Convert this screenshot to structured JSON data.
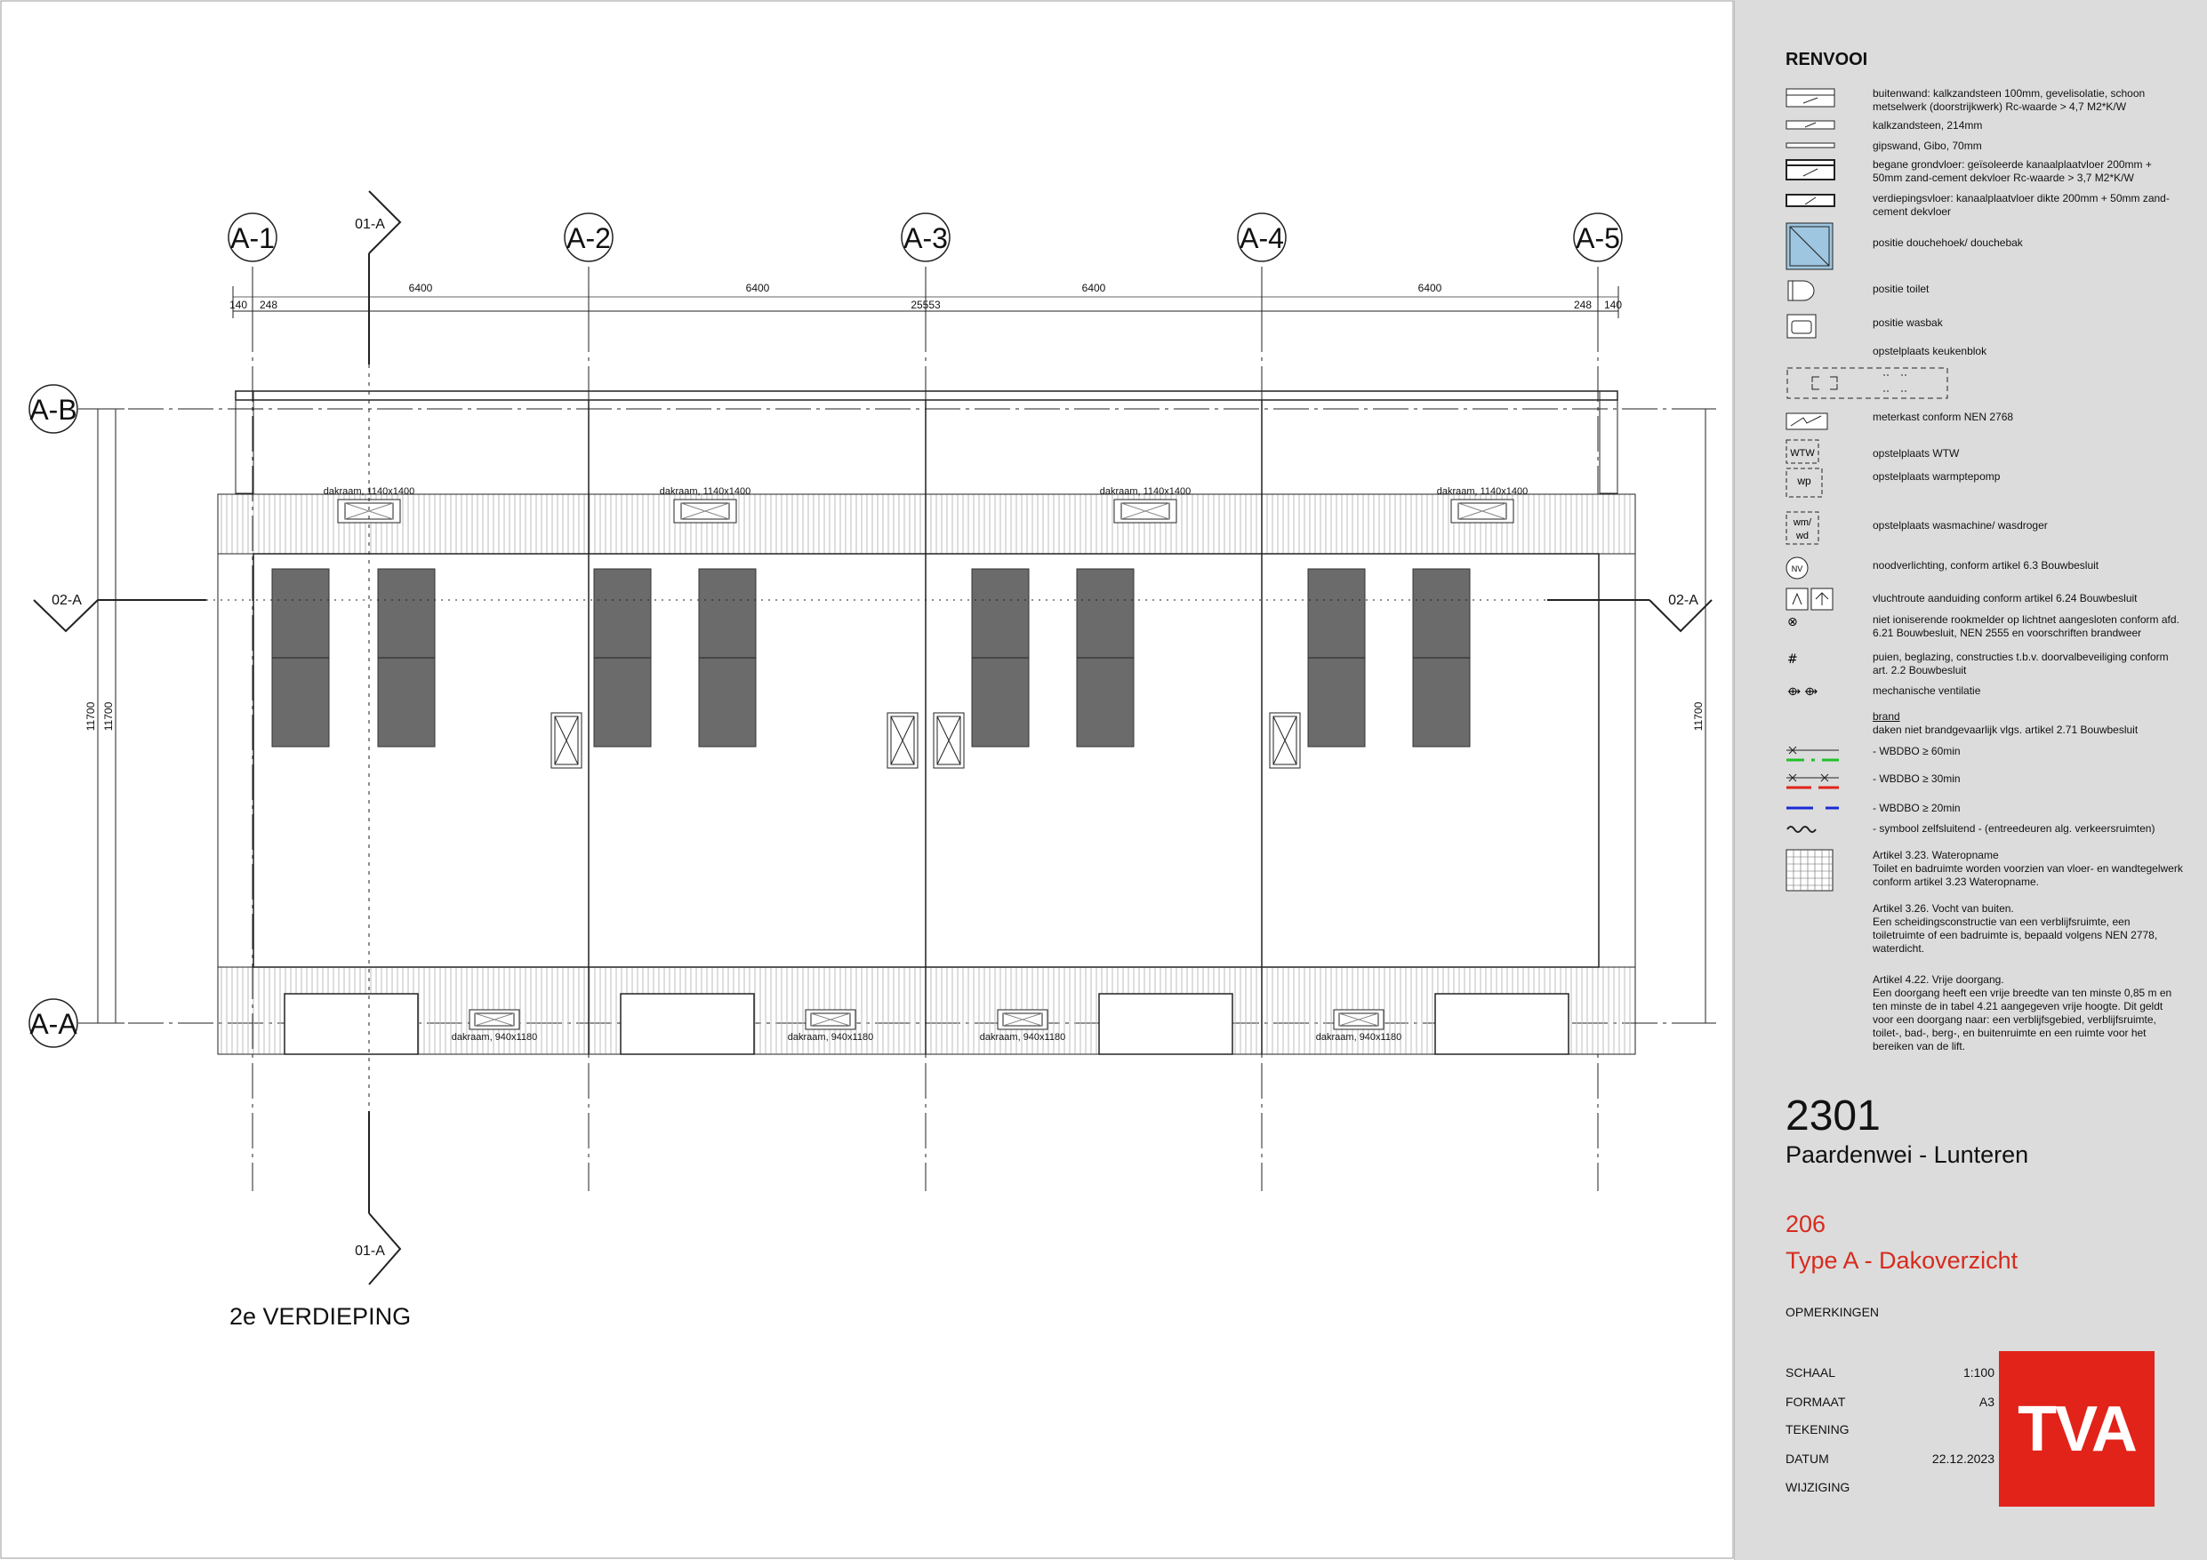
{
  "grid": {
    "columns": [
      "A-1",
      "A-2",
      "A-3",
      "A-4",
      "A-5"
    ],
    "rows": [
      "A-B",
      "A-A"
    ],
    "dims_top": [
      "140",
      "248",
      "6400",
      "6400",
      "25553",
      "6400",
      "6400",
      "248",
      "140"
    ],
    "dims_side": [
      "11700",
      "11700",
      "11700"
    ]
  },
  "sections": {
    "vertical": "01-A",
    "horizontal": "02-A"
  },
  "skylights": {
    "top": [
      "dakraam, 1140x1400",
      "dakraam, 1140x1400",
      "dakraam, 1140x1400",
      "dakraam, 1140x1400"
    ],
    "bottom": [
      "dakraam, 940x1180",
      "dakraam, 940x1180",
      "dakraam, 940x1180",
      "dakraam, 940x1180"
    ]
  },
  "floor_label": "2e VERDIEPING",
  "legend": {
    "title": "RENVOOI",
    "items": [
      "buitenwand: kalkzandsteen 100mm, gevelisolatie, schoon metselwerk (doorstrijkwerk) Rc-waarde > 4,7 M2*K/W",
      "kalkzandsteen, 214mm",
      "gipswand, Gibo, 70mm",
      "begane grondvloer: geïsoleerde kanaalplaatvloer 200mm + 50mm zand-cement dekvloer Rc-waarde > 3,7 M2*K/W",
      "verdiepingsvloer: kanaalplaatvloer dikte 200mm + 50mm zand-cement dekvloer",
      "positie douchehoek/ douchebak",
      "positie toilet",
      "positie wasbak",
      "opstelplaats keukenblok",
      "meterkast conform NEN 2768",
      "opstelplaats WTW",
      "opstelplaats warmptepomp",
      "opstelplaats wasmachine/ wasdroger",
      "noodverlichting, conform artikel 6.3 Bouwbesluit",
      "vluchtroute aanduiding conform artikel 6.24 Bouwbesluit",
      "niet ioniserende rookmelder op lichtnet aangesloten conform afd. 6.21 Bouwbesluit, NEN 2555 en voorschriften brandweer",
      "puien, beglazing, constructies t.b.v. doorvalbeveiliging conform art. 2.2 Bouwbesluit",
      "mechanische ventilatie"
    ],
    "sym_labels": {
      "wtw": "WTW",
      "wp": "wp",
      "wm": "wm/",
      "wd": "wd",
      "nv": "NV",
      "smoke": "⊗",
      "hash": "#",
      "vent": "⟴ ⟴"
    },
    "brand_heading": "brand",
    "brand_note": "daken niet brandgevaarlijk vlgs. artikel 2.71 Bouwbesluit",
    "brand_items": [
      "- WBDBO ≥ 60min",
      "- WBDBO ≥ 30min",
      "- WBDBO ≥ 20min",
      "- symbool zelfsluitend - (entreedeuren alg. verkeersruimten)"
    ],
    "brand_colors": [
      "#22c02a",
      "#e2231a",
      "#1a2bd6"
    ],
    "articles": [
      "Artikel 3.23. Wateropname\nToilet en badruimte worden voorzien van vloer- en wandtegelwerk conform artikel 3.23 Wateropname.",
      "Artikel 3.26. Vocht van buiten.\nEen scheidingsconstructie van een verblijfsruimte, een toiletruimte of een badruimte is, bepaald volgens NEN 2778, waterdicht.",
      "Artikel 4.22. Vrije doorgang.\nEen doorgang heeft een vrije breedte van ten minste 0,85 m en ten minste de in tabel 4.21 aangegeven vrije hoogte. Dit geldt voor een doorgang naar: een verblijfsgebied, verblijfsruimte, toilet-, bad-, berg-, en buitenruimte en een ruimte voor het bereiken van de lift."
    ]
  },
  "title_block": {
    "project_number": "2301",
    "project_name": "Paardenwei - Lunteren",
    "drawing_number": "206",
    "drawing_title": "Type A - Dakoverzicht",
    "remarks_label": "OPMERKINGEN",
    "scale_label": "SCHAAL",
    "scale_value": "1:100",
    "format_label": "FORMAAT",
    "format_value": "A3",
    "drawing_label": "TEKENING",
    "date_label": "DATUM",
    "date_value": "22.12.2023",
    "revision_label": "WIJZIGING",
    "logo": "TVA",
    "accent_color": "#e2231a"
  }
}
